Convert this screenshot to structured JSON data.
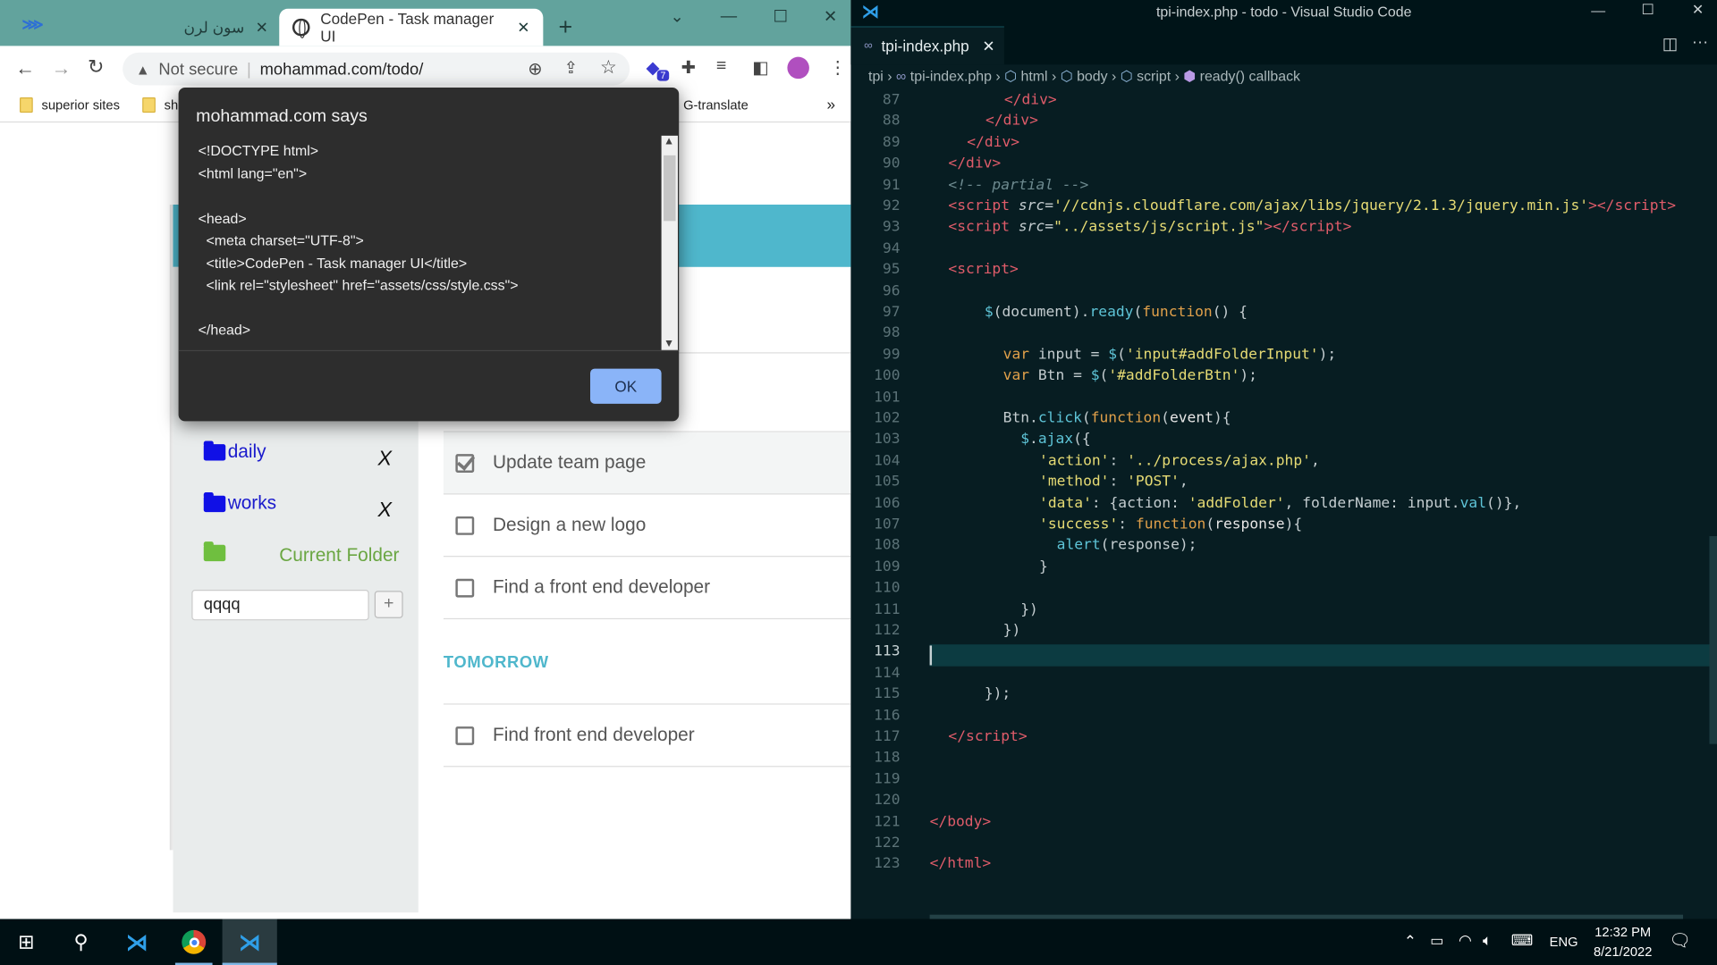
{
  "chrome": {
    "tabs": [
      {
        "title": "سون لرن",
        "close": "✕"
      },
      {
        "title": "CodePen - Task manager UI",
        "close": "✕"
      }
    ],
    "new_tab": "+",
    "address": {
      "warning": "Not secure",
      "url": "mohammad.com/todo/"
    },
    "extension_badge": "7",
    "bookmarks": [
      "superior sites",
      "sh",
      "G-translate"
    ],
    "bookmarks_more": "»"
  },
  "dialog": {
    "title": "mohammad.com says",
    "message": "<!DOCTYPE html>\n<html lang=\"en\">\n\n<head>\n  <meta charset=\"UTF-8\">\n  <title>CodePen - Task manager UI</title>\n  <link rel=\"stylesheet\" href=\"assets/css/style.css\">\n\n</head>",
    "ok_label": "OK"
  },
  "app": {
    "folders": [
      {
        "name": "daily",
        "delete": "X"
      },
      {
        "name": "works",
        "delete": "X"
      }
    ],
    "current_folder": "Current Folder",
    "folder_input_value": "qqqq",
    "add_button": "+",
    "tasks_today": [
      {
        "label": "Update team page",
        "checked": true
      },
      {
        "label": "Design a new logo",
        "checked": false
      },
      {
        "label": "Find a front end developer",
        "checked": false
      }
    ],
    "section_tomorrow": "TOMORROW",
    "tasks_tomorrow": [
      {
        "label": "Find front end developer",
        "checked": false
      }
    ]
  },
  "vscode": {
    "title": "tpi-index.php - todo - Visual Studio Code",
    "tab": "tpi-index.php",
    "tab_close": "✕",
    "breadcrumbs": [
      "tpi",
      "tpi-index.php",
      "html",
      "body",
      "script",
      "ready() callback"
    ],
    "current_line": "113",
    "line_numbers": [
      "87",
      "88",
      "89",
      "90",
      "91",
      "92",
      "93",
      "94",
      "95",
      "96",
      "97",
      "98",
      "99",
      "100",
      "101",
      "102",
      "103",
      "104",
      "105",
      "106",
      "107",
      "108",
      "109",
      "110",
      "111",
      "112",
      "113",
      "114",
      "115",
      "116",
      "117",
      "118",
      "119",
      "120",
      "121",
      "122",
      "123"
    ]
  },
  "taskbar": {
    "language": "ENG",
    "time": "12:32 PM",
    "date": "8/21/2022"
  }
}
